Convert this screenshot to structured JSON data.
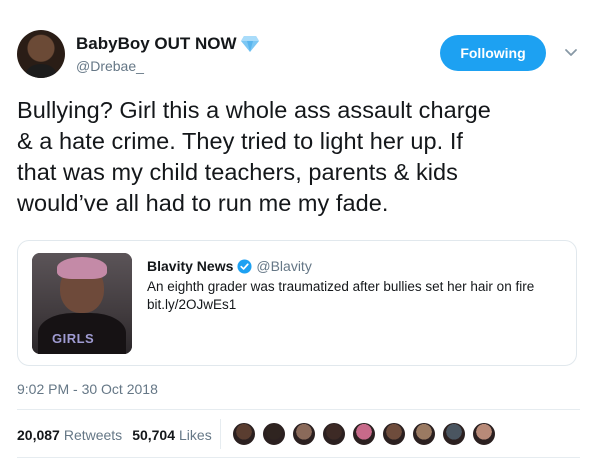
{
  "author": {
    "display_name": "BabyBoy OUT NOW",
    "handle": "@Drebae_",
    "avatar_icon": "user-avatar",
    "name_emoji": "gem-icon"
  },
  "follow_button": {
    "label": "Following",
    "color": "#1da1f2"
  },
  "tweet": {
    "lines": [
      "Bullying? Girl this a whole ass assault charge",
      "& a hate crime. They tried to light her up. If",
      "that was my child teachers, parents & kids",
      "would’ve all had to run me my fade."
    ]
  },
  "quoted": {
    "name": "Blavity News",
    "handle": "@Blavity",
    "verified": true,
    "text": "An eighth grader was traumatized after bullies set her hair on fire",
    "link": "bit.ly/2OJwEs1",
    "thumb_text": "GIRLS"
  },
  "timestamp": "9:02 PM - 30 Oct 2018",
  "stats": {
    "retweets_count": "20,087",
    "retweets_label": "Retweets",
    "likes_count": "50,704",
    "likes_label": "Likes"
  },
  "likers": [
    {
      "color": "#5a3d30"
    },
    {
      "color": "#2f2420"
    },
    {
      "color": "#8a6a5a"
    },
    {
      "color": "#3d2a25"
    },
    {
      "color": "#c76a8a"
    },
    {
      "color": "#6e4c3c"
    },
    {
      "color": "#9a7a62"
    },
    {
      "color": "#4a5560"
    },
    {
      "color": "#b88a78"
    }
  ]
}
